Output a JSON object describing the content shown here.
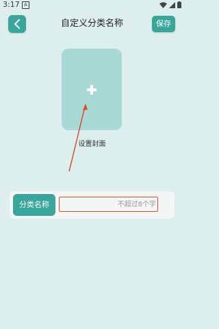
{
  "status_bar": {
    "time": "3:17",
    "notification_glyph": "A",
    "icons": [
      "wifi-icon",
      "signal-icon",
      "battery-icon"
    ]
  },
  "header": {
    "title": "自定义分类名称",
    "save_label": "保存",
    "back_icon": "chevron-left-icon"
  },
  "cover": {
    "add_icon": "plus-icon",
    "label": "设置封面"
  },
  "name_field": {
    "label": "分类名称",
    "value": "",
    "placeholder": "不超过8个字"
  },
  "colors": {
    "background": "#dcefec",
    "accent": "#3aa59a",
    "cover_fill": "#a9d9d4",
    "annotation": "#d94a2e"
  }
}
